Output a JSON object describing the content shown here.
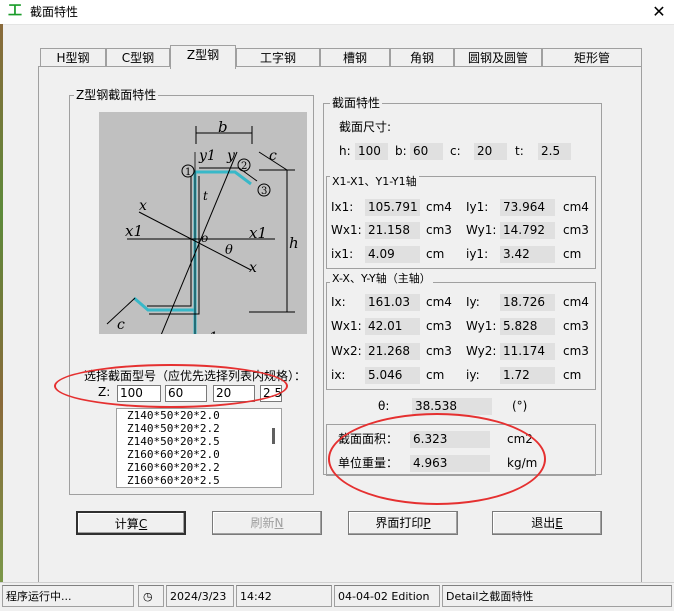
{
  "window": {
    "title": "截面特性",
    "close_glyph": "✕"
  },
  "tabs": [
    "H型钢",
    "C型钢",
    "Z型钢",
    "工字钢",
    "槽钢",
    "角钢",
    "圆钢及圆管",
    "矩形管"
  ],
  "active_tab": "Z型钢",
  "left_group": {
    "title": "Z型钢截面特性",
    "diagram_labels": {
      "b": "b",
      "c": "c",
      "h": "h",
      "t": "t",
      "o": "o",
      "theta": "θ",
      "x": "x",
      "x1": "x1",
      "y": "y",
      "y1": "y1",
      "n1": "1",
      "n2": "2",
      "n3": "3"
    },
    "select_prompt": "选择截面型号（应优先选择列表内规格）：",
    "z_label": "Z:",
    "inputs": [
      "100",
      "60",
      "20",
      "2.5"
    ],
    "list_items": [
      "Z140*50*20*2.0",
      "Z140*50*20*2.2",
      "Z140*50*20*2.5",
      "Z160*60*20*2.0",
      "Z160*60*20*2.2",
      "Z160*60*20*2.5"
    ]
  },
  "right_group": {
    "title": "截面特性",
    "dims_title": "截面尺寸:",
    "dims": [
      {
        "label": "h:",
        "value": "100"
      },
      {
        "label": "b:",
        "value": "60"
      },
      {
        "label": "c:",
        "value": "20"
      },
      {
        "label": "t:",
        "value": "2.5"
      }
    ],
    "axis1_title": "X1-X1、Y1-Y1轴",
    "axis1_rows": [
      {
        "l1": "Ix1:",
        "v1": "105.791",
        "u1": "cm4",
        "l2": "Iy1:",
        "v2": "73.964",
        "u2": "cm4"
      },
      {
        "l1": "Wx1:",
        "v1": "21.158",
        "u1": "cm3",
        "l2": "Wy1:",
        "v2": "14.792",
        "u2": "cm3"
      },
      {
        "l1": "ix1:",
        "v1": "4.09",
        "u1": "cm",
        "l2": "iy1:",
        "v2": "3.42",
        "u2": "cm"
      }
    ],
    "axis2_title": "X-X、Y-Y轴（主轴）",
    "axis2_rows": [
      {
        "l1": "Ix:",
        "v1": "161.03",
        "u1": "cm4",
        "l2": "Iy:",
        "v2": "18.726",
        "u2": "cm4"
      },
      {
        "l1": "Wx1:",
        "v1": "42.01",
        "u1": "cm3",
        "l2": "Wy1:",
        "v2": "5.828",
        "u2": "cm3"
      },
      {
        "l1": "Wx2:",
        "v1": "21.268",
        "u1": "cm3",
        "l2": "Wy2:",
        "v2": "11.174",
        "u2": "cm3"
      },
      {
        "l1": "ix:",
        "v1": "5.046",
        "u1": "cm",
        "l2": "iy:",
        "v2": "1.72",
        "u2": "cm"
      }
    ],
    "theta": {
      "label": "θ:",
      "value": "38.538",
      "unit": "(°)"
    },
    "area": {
      "label": "截面面积：",
      "value": "6.323",
      "unit": "cm2"
    },
    "weight": {
      "label": "单位重量：",
      "value": "4.963",
      "unit": "kg/m"
    }
  },
  "buttons": {
    "calc": {
      "text": "计算",
      "key": "C"
    },
    "refresh": {
      "text": "刷新",
      "key": "N"
    },
    "print": {
      "text": "界面打印",
      "key": "P"
    },
    "exit": {
      "text": "退出",
      "key": "E"
    }
  },
  "status": {
    "running": "程序运行中...",
    "date": "2024/3/23",
    "time": "14:42",
    "edition": "04-04-02 Edition",
    "detail": "Detail之截面特性"
  },
  "colors": {
    "accent": "#1a9c2a",
    "annotation": "#e53030",
    "profile": "#38b8c8"
  }
}
